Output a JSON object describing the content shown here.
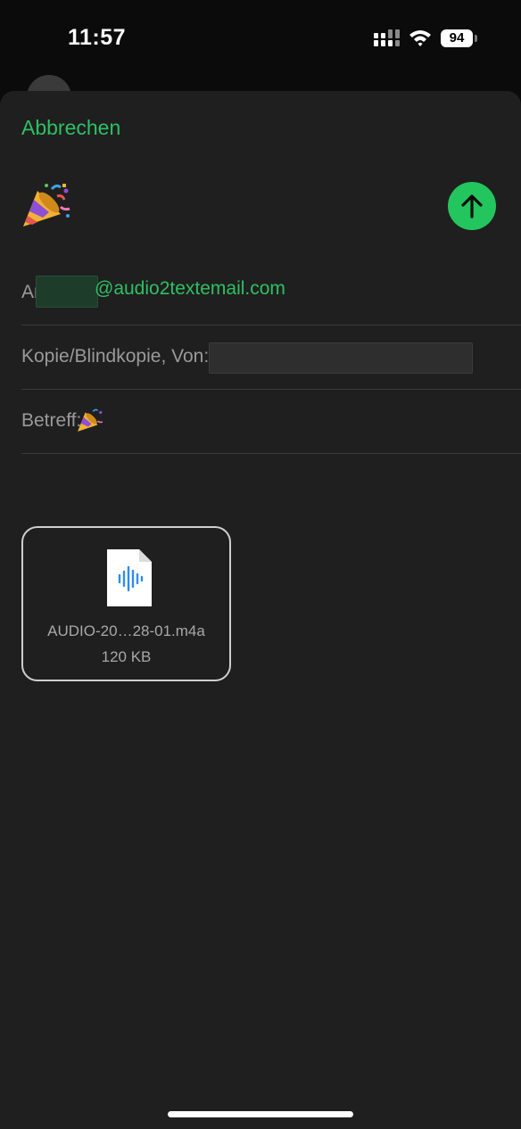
{
  "status_bar": {
    "time": "11:57",
    "battery_level": "94",
    "icons": [
      "signal-icon",
      "wifi-icon",
      "battery-icon"
    ]
  },
  "compose": {
    "cancel_label": "Abbrechen",
    "header_emoji_icon": "party-popper-icon",
    "send_icon": "arrow-up-icon",
    "to": {
      "label": "An:",
      "address_domain": "@audio2textemail.com"
    },
    "cc": {
      "label": "Kopie/Blindkopie, Von:"
    },
    "subject": {
      "label": "Betreff:",
      "emoji_icon": "party-popper-icon"
    },
    "attachment": {
      "file_name": "AUDIO-20…28-01.m4a",
      "file_size": "120 KB",
      "icon": "audio-file-icon"
    }
  },
  "colors": {
    "accent": "#2ec064",
    "send_button": "#23c55e",
    "sheet_background": "#1f1f1f",
    "label_text": "#9a9a9a"
  }
}
